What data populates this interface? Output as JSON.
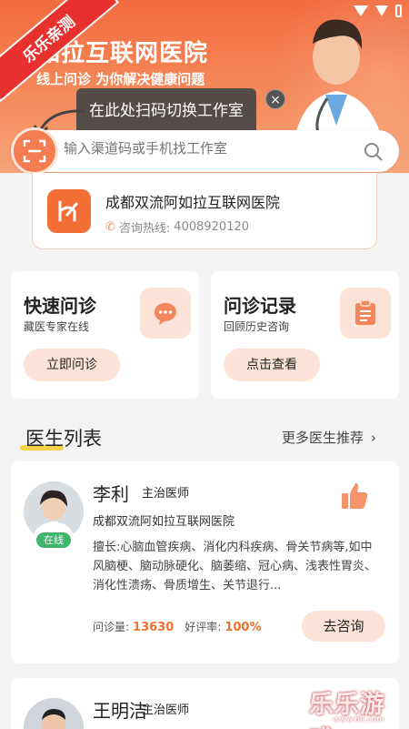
{
  "banner": {
    "title": "如拉互联网医院",
    "subtitle": "线上问诊  为你解决健康问题",
    "corner_tag": "乐乐亲测"
  },
  "tooltip": {
    "text": "在此处扫码切换工作室",
    "close_icon": "×"
  },
  "search": {
    "placeholder": "输入渠道码或手机找工作室"
  },
  "hospital": {
    "name": "成都双流阿如拉互联网医院",
    "hotline_label": "咨询热线:",
    "hotline_number": "4008920120"
  },
  "quick_cards": [
    {
      "title": "快速问诊",
      "subtitle": "藏医专家在线",
      "button": "立即问诊",
      "icon": "chat-icon"
    },
    {
      "title": "问诊记录",
      "subtitle": "回顾历史咨询",
      "button": "点击查看",
      "icon": "clipboard-icon"
    }
  ],
  "doctor_section": {
    "title": "医生列表",
    "more": "更多医生推荐",
    "more_icon": "›"
  },
  "doctors": [
    {
      "name": "李利",
      "title": "主治医师",
      "hospital": "成都双流阿如拉互联网医院",
      "status": "在线",
      "description": "擅长:心脑血管疾病、消化内科疾病、骨关节病等,如中风脑梗、脑动脉硬化、脑萎缩、冠心病、浅表性胃炎、消化性溃疡、骨质增生、关节退行...",
      "consult_label": "问诊量:",
      "consult_count": "13630",
      "rating_label": "好评率:",
      "rating": "100%",
      "button": "去咨询"
    },
    {
      "name": "王明洁",
      "title": "主治医师"
    }
  ],
  "watermark": {
    "text": "乐乐游戏",
    "url": "www.6ll.com"
  },
  "colors": {
    "accent": "#f36d36",
    "online": "#3fb56c",
    "soft_accent": "#fde3d7"
  }
}
